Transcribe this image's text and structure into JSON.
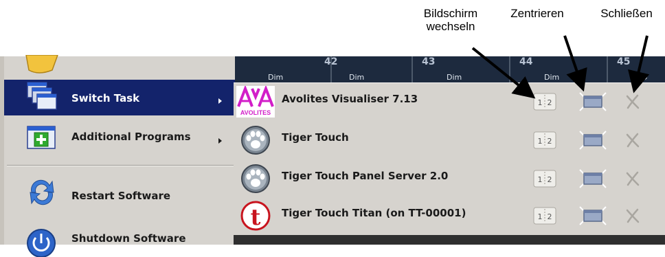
{
  "annotations": {
    "switch_screen": [
      "Bildschirm",
      "wechseln"
    ],
    "center": "Zentrieren",
    "close": "Schließen"
  },
  "console": {
    "faders": [
      {
        "num": "",
        "label": "Dim"
      },
      {
        "num": "42",
        "label": "Dim"
      },
      {
        "num": "43",
        "label": "Dim"
      },
      {
        "num": "44",
        "label": "Dim"
      },
      {
        "num": "45",
        "label": "D"
      }
    ]
  },
  "menu": {
    "items": [
      {
        "label": "Switch Task",
        "icon": "windows-stack-icon",
        "submenu": true,
        "selected": true
      },
      {
        "label": "Additional Programs",
        "icon": "add-window-icon",
        "submenu": true
      },
      {
        "label": "Restart Software",
        "icon": "restart-arrows-icon"
      },
      {
        "label": "Shutdown Software",
        "icon": "power-icon"
      }
    ]
  },
  "tasks": [
    {
      "label": "Avolites Visualiser 7.13",
      "logo": "avolites-logo",
      "logo_text": "AVOLITES"
    },
    {
      "label": "Tiger Touch",
      "logo": "paw-icon"
    },
    {
      "label": "Tiger Touch Panel Server 2.0",
      "logo": "paw-icon"
    },
    {
      "label": "Tiger Touch Titan (on TT-00001)",
      "logo": "titan-t-icon",
      "logo_text": "t"
    }
  ],
  "task_buttons": {
    "switch_screen_text": [
      "1",
      "2"
    ],
    "switch_screen_icon": "switch-screen-icon",
    "center_icon": "center-window-icon",
    "close_icon": "close-x-icon"
  },
  "colors": {
    "menu_bg": "#d6d3ce",
    "selected_bg": "#13236b",
    "console_bg": "#1d2a3e",
    "avolites_magenta": "#d21ec8",
    "titan_red": "#c8141e"
  }
}
